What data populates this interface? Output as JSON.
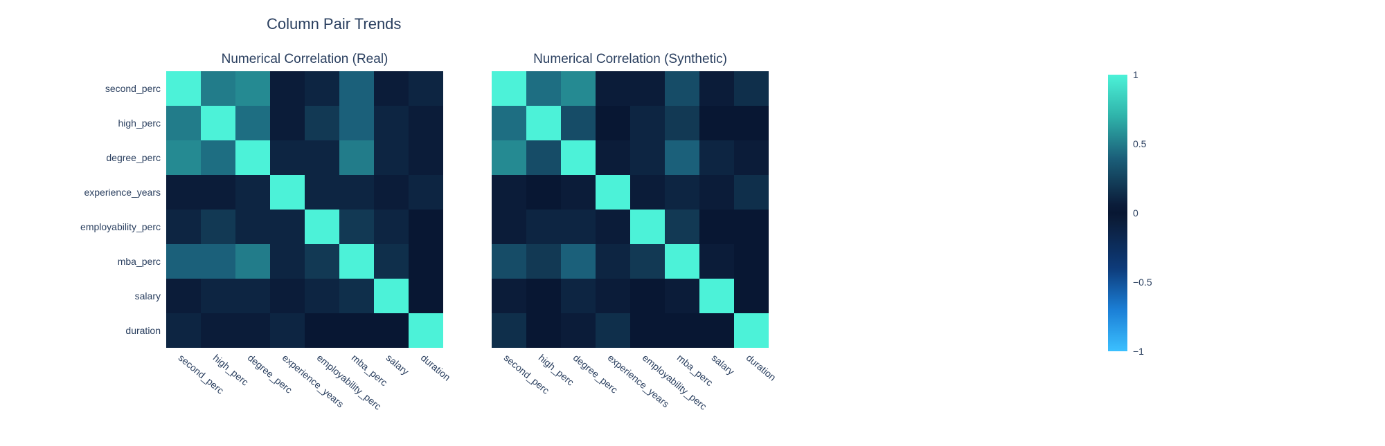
{
  "title": "Column Pair Trends",
  "subplots": [
    {
      "title": "Numerical Correlation (Real)"
    },
    {
      "title": "Numerical Correlation (Synthetic)"
    }
  ],
  "labels": [
    "second_perc",
    "high_perc",
    "degree_perc",
    "experience_years",
    "employability_perc",
    "mba_perc",
    "salary",
    "duration"
  ],
  "colorbar_ticks": [
    {
      "pos": 0.0,
      "label": "1"
    },
    {
      "pos": 0.25,
      "label": "0.5"
    },
    {
      "pos": 0.5,
      "label": "0"
    },
    {
      "pos": 0.75,
      "label": "−0.5"
    },
    {
      "pos": 1.0,
      "label": "−1"
    }
  ],
  "chart_data": [
    {
      "type": "heatmap",
      "title": "Numerical Correlation (Real)",
      "xlabel": "",
      "ylabel": "",
      "categories": [
        "second_perc",
        "high_perc",
        "degree_perc",
        "experience_years",
        "employability_perc",
        "mba_perc",
        "salary",
        "duration"
      ],
      "zmin": -1,
      "zmax": 1,
      "z": [
        [
          1.0,
          0.5,
          0.55,
          0.05,
          0.1,
          0.4,
          0.05,
          0.1
        ],
        [
          0.5,
          1.0,
          0.45,
          0.05,
          0.2,
          0.4,
          0.1,
          0.05
        ],
        [
          0.55,
          0.45,
          1.0,
          0.1,
          0.1,
          0.5,
          0.1,
          0.05
        ],
        [
          0.05,
          0.05,
          0.1,
          1.0,
          0.1,
          0.1,
          0.05,
          0.1
        ],
        [
          0.1,
          0.2,
          0.1,
          0.1,
          1.0,
          0.2,
          0.1,
          0.0
        ],
        [
          0.4,
          0.4,
          0.5,
          0.1,
          0.2,
          1.0,
          0.15,
          0.0
        ],
        [
          0.05,
          0.1,
          0.1,
          0.05,
          0.1,
          0.15,
          1.0,
          0.0
        ],
        [
          0.1,
          0.05,
          0.05,
          0.1,
          0.0,
          0.0,
          0.0,
          1.0
        ]
      ]
    },
    {
      "type": "heatmap",
      "title": "Numerical Correlation (Synthetic)",
      "xlabel": "",
      "ylabel": "",
      "categories": [
        "second_perc",
        "high_perc",
        "degree_perc",
        "experience_years",
        "employability_perc",
        "mba_perc",
        "salary",
        "duration"
      ],
      "zmin": -1,
      "zmax": 1,
      "z": [
        [
          1.0,
          0.45,
          0.55,
          0.05,
          0.05,
          0.3,
          0.05,
          0.15
        ],
        [
          0.45,
          1.0,
          0.3,
          0.0,
          0.1,
          0.2,
          0.0,
          0.0
        ],
        [
          0.55,
          0.3,
          1.0,
          0.05,
          0.1,
          0.4,
          0.1,
          0.05
        ],
        [
          0.05,
          0.0,
          0.05,
          1.0,
          0.05,
          0.1,
          0.05,
          0.15
        ],
        [
          0.05,
          0.1,
          0.1,
          0.05,
          1.0,
          0.2,
          0.0,
          0.0
        ],
        [
          0.3,
          0.2,
          0.4,
          0.1,
          0.2,
          1.0,
          0.05,
          0.0
        ],
        [
          0.05,
          0.0,
          0.1,
          0.05,
          0.0,
          0.05,
          1.0,
          0.0
        ],
        [
          0.15,
          0.0,
          0.05,
          0.15,
          0.0,
          0.0,
          0.0,
          1.0
        ]
      ]
    }
  ]
}
